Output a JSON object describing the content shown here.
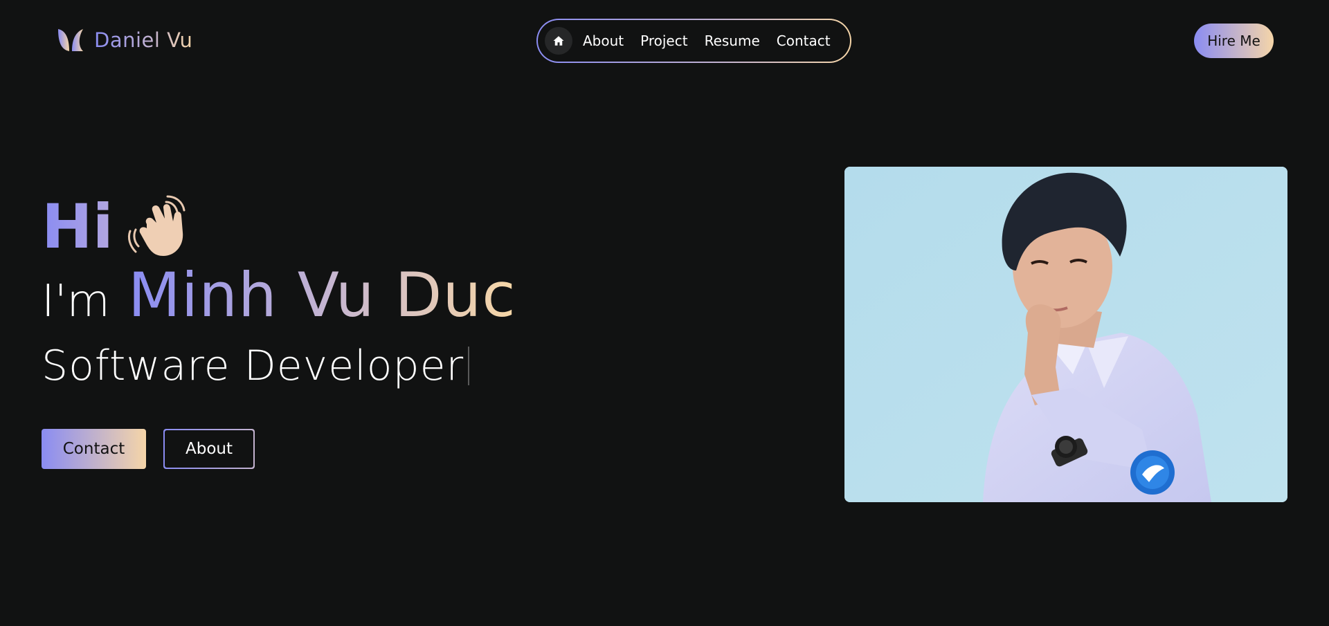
{
  "header": {
    "brand_name": "Daniel Vu",
    "nav": {
      "home_icon": "home-icon",
      "links": [
        {
          "label": "About"
        },
        {
          "label": "Project"
        },
        {
          "label": "Resume"
        },
        {
          "label": "Contact"
        }
      ]
    },
    "hire_label": "Hire Me"
  },
  "hero": {
    "greeting": "Hi",
    "wave_icon": "waving-hand-icon",
    "intro": "I'm",
    "name": "Minh Vu Duc",
    "role": "Software Developer",
    "contact_label": "Contact",
    "about_label": "About"
  },
  "colors": {
    "background": "#111212",
    "gradient_start": "#8a8cf2",
    "gradient_end": "#f5d5a8",
    "portrait_background": "#b6dcec"
  }
}
